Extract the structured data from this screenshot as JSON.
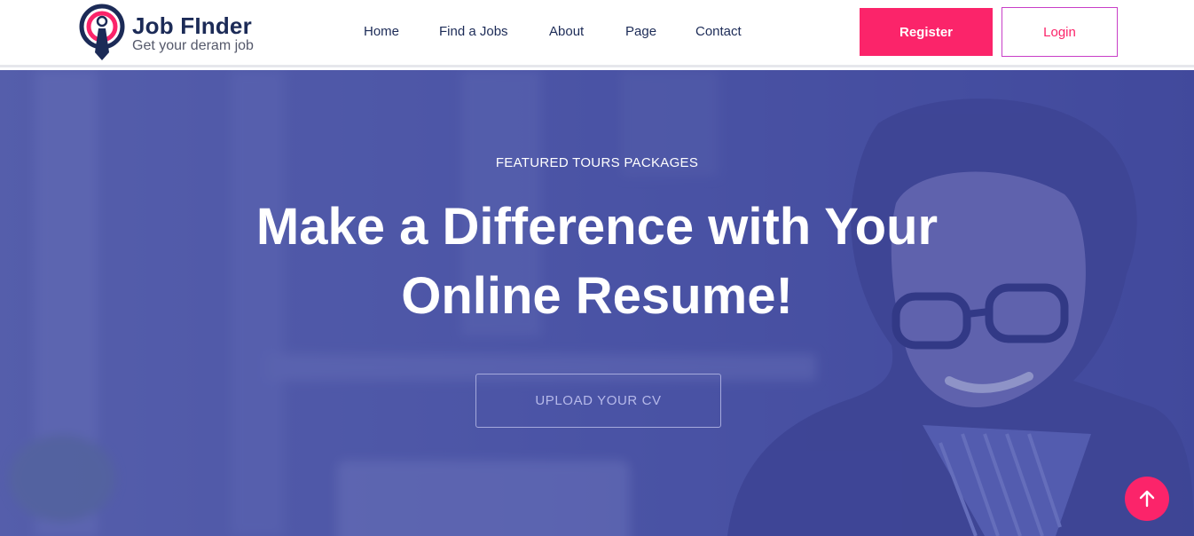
{
  "header": {
    "logo_title": "Job FInder",
    "logo_tagline": "Get your deram job",
    "nav": [
      {
        "label": "Home"
      },
      {
        "label": "Find a Jobs"
      },
      {
        "label": "About"
      },
      {
        "label": "Page"
      },
      {
        "label": "Contact"
      }
    ],
    "register_label": "Register",
    "login_label": "Login"
  },
  "hero": {
    "eyebrow": "FEATURED TOURS PACKAGES",
    "headline": "Make a Difference with Your Online Resume!",
    "cta_label": "UPLOAD YOUR CV"
  },
  "icons": {
    "logo": "target-with-tie-icon",
    "scroll_top": "arrow-up-icon"
  },
  "colors": {
    "brand_navy": "#1c2b57",
    "accent_pink": "#fb246a",
    "hero_overlay": "#4b5198"
  }
}
